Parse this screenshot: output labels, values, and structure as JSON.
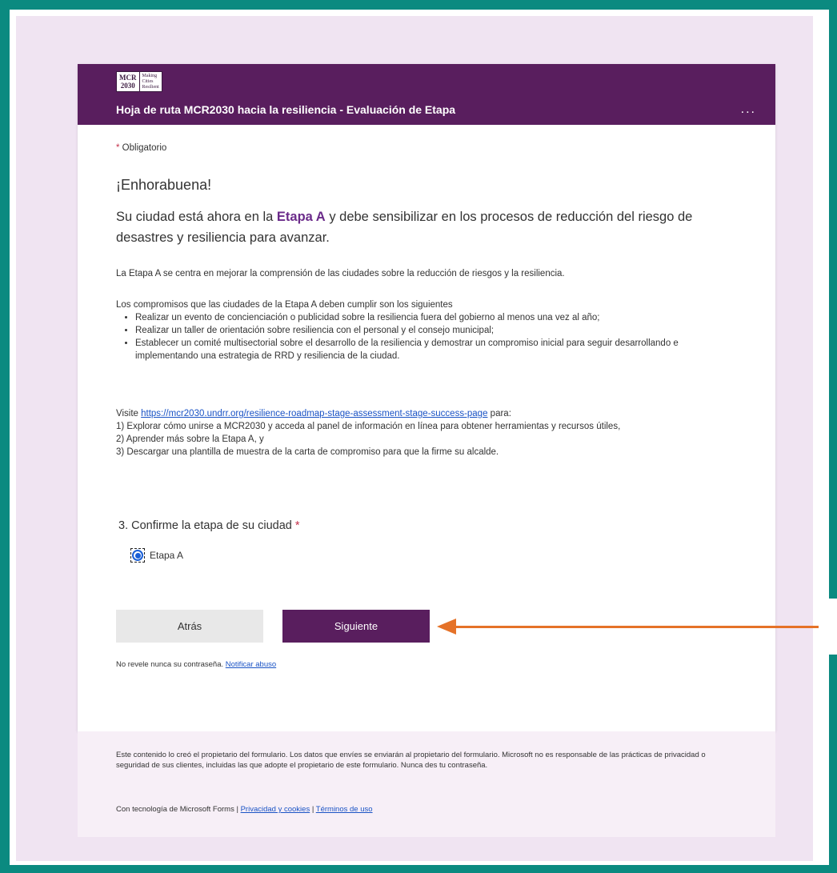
{
  "logo": {
    "box_line1": "MCR",
    "box_line2": "2030",
    "txt_line1": "Making",
    "txt_line2": "Cities",
    "txt_line3": "Resilient"
  },
  "header": {
    "title": "Hoja de ruta MCR2030 hacia la resiliencia - Evaluación de Etapa",
    "more": "..."
  },
  "required_note": {
    "star": "*",
    "text": " Obligatorio"
  },
  "congrats": "¡Enhorabuena!",
  "lead": {
    "before": "Su ciudad está ahora en la ",
    "stage": "Etapa A",
    "after": " y debe sensibilizar en los procesos de reducción del riesgo de desastres y resiliencia para avanzar."
  },
  "para1": "La Etapa A se centra en mejorar la comprensión de las ciudades sobre la reducción de riesgos y la resiliencia.",
  "para2": "Los compromisos que las ciudades de la Etapa A deben cumplir son los siguientes",
  "bullets": [
    "Realizar un evento de concienciación o publicidad sobre la resiliencia fuera del gobierno al menos una vez al año;",
    "Realizar un taller de orientación sobre resiliencia con el personal y el consejo municipal;",
    "Establecer un comité multisectorial sobre el desarrollo de la resiliencia y demostrar un compromiso inicial para seguir desarrollando e implementando una estrategia de RRD y resiliencia de la ciudad."
  ],
  "visit": {
    "prefix": "Visite ",
    "link": "https://mcr2030.undrr.org/resilience-roadmap-stage-assessment-stage-success-page",
    "suffix": " para:",
    "items": [
      "1) Explorar cómo unirse a MCR2030 y acceda al panel de información en línea para obtener herramientas y recursos útiles,",
      "2) Aprender más sobre la Etapa A, y",
      "3) Descargar una plantilla de muestra de la carta de compromiso para que la firme su alcalde."
    ]
  },
  "question": {
    "number": "3.",
    "text": "Confirme la etapa de su ciudad",
    "star": "*"
  },
  "option": {
    "label": "Etapa A",
    "selected": true
  },
  "buttons": {
    "back": "Atrás",
    "next": "Siguiente"
  },
  "note": {
    "text": "No revele nunca su contraseña. ",
    "link": "Notificar abuso"
  },
  "footer": {
    "text": "Este contenido lo creó el propietario del formulario. Los datos que envíes se enviarán al propietario del formulario. Microsoft no es responsable de las prácticas de privacidad o seguridad de sus clientes, incluidas las que adopte el propietario de este formulario. Nunca des tu contraseña.",
    "powered": "Con tecnología de Microsoft Forms | ",
    "privacy": "Privacidad y cookies",
    "sep": " | ",
    "terms": "Términos de uso"
  },
  "colors": {
    "frame": "#0b8a80",
    "header": "#591e5e",
    "accent": "#6b2b8a",
    "arrow": "#e57228",
    "link": "#1a53c5"
  }
}
